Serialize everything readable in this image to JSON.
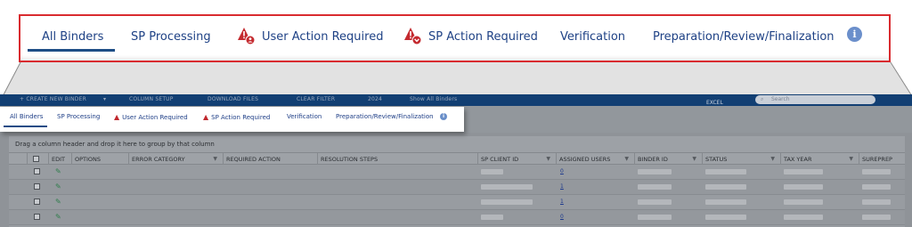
{
  "zoom_tabs": {
    "all_binders": "All Binders",
    "sp_processing": "SP Processing",
    "user_action_required": "User Action Required",
    "sp_action_required": "SP Action Required",
    "verification": "Verification",
    "prep_review_final": "Preparation/Review/Finalization",
    "info": "i",
    "active": "All Binders"
  },
  "mini_tabs": {
    "all_binders": "All Binders",
    "sp_processing": "SP Processing",
    "user_action_required": "User Action Required",
    "sp_action_required": "SP Action Required",
    "verification": "Verification",
    "prep_review_final": "Preparation/Review/Finalization",
    "info": "i"
  },
  "toolbar": {
    "create_new_binder": "+ CREATE NEW BINDER",
    "column_setup": "COLUMN SETUP",
    "download_files": "DOWNLOAD FILES",
    "clear_filter": "CLEAR FILTER",
    "year": "2024",
    "show_all_binders": "Show All Binders",
    "excel": "EXCEL",
    "search_placeholder": "Search"
  },
  "grid": {
    "drag_hint": "Drag a column header and drop it here to group by that column",
    "columns": [
      "EDIT",
      "OPTIONS",
      "ERROR CATEGORY",
      "REQUIRED ACTION",
      "RESOLUTION STEPS",
      "SP CLIENT ID",
      "ASSIGNED USERS",
      "BINDER ID",
      "STATUS",
      "TAX YEAR",
      "SUREPREP"
    ],
    "rows": [
      {
        "assigned_users": "0"
      },
      {
        "assigned_users": "1"
      },
      {
        "assigned_users": "1"
      },
      {
        "assigned_users": "0"
      }
    ]
  },
  "colors": {
    "accent": "#1e4185",
    "callout_border": "#d92b2f",
    "warning": "#c0282e",
    "topbar": "#123f73"
  }
}
